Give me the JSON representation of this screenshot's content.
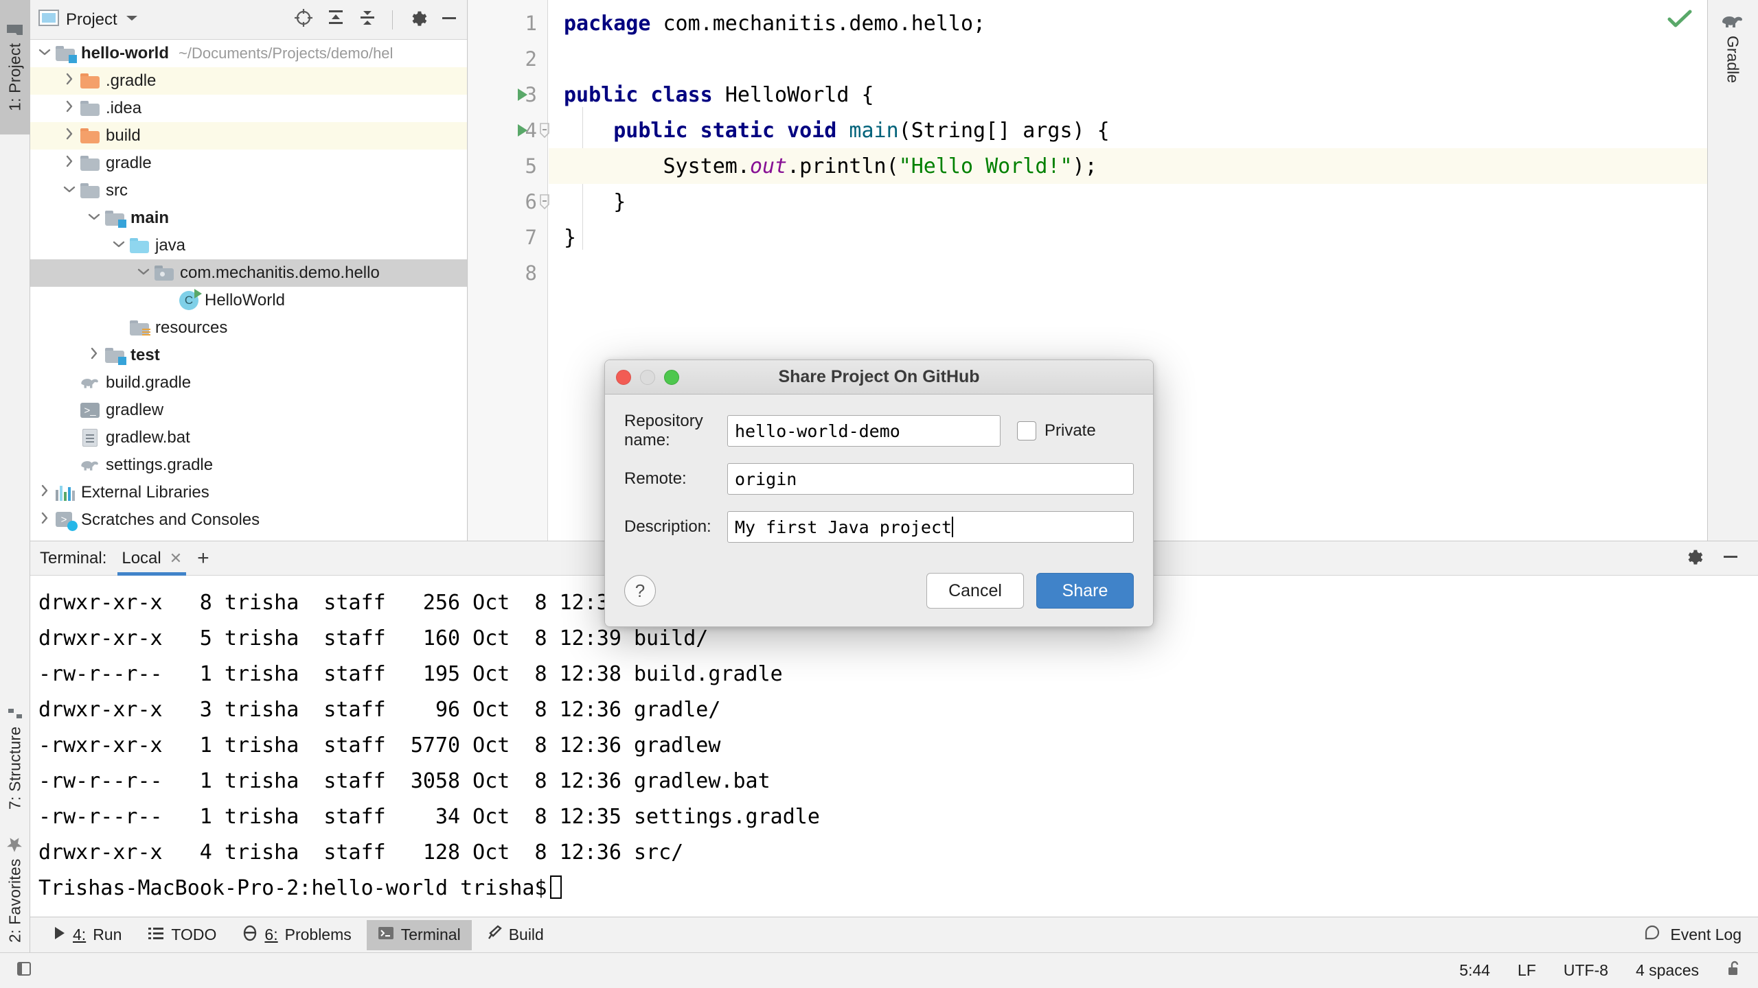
{
  "left_tabs": [
    {
      "label": "1: Project",
      "number": "1:",
      "name": "Project",
      "icon": "project-folder-icon",
      "active": true
    },
    {
      "label": "7: Structure",
      "number": "7:",
      "name": "Structure",
      "icon": "structure-icon",
      "active": false
    },
    {
      "label": "2: Favorites",
      "number": "2:",
      "name": "Favorites",
      "icon": "star-icon",
      "active": false
    }
  ],
  "right_tabs": [
    {
      "label": "Gradle",
      "icon": "gradle-elephant-icon"
    }
  ],
  "project_panel": {
    "title": "Project",
    "toolbar_icons": [
      "locate-icon",
      "expand-all-icon",
      "collapse-all-icon",
      "gear-icon",
      "hide-icon"
    ],
    "tree": [
      {
        "indent": 0,
        "twist": "v",
        "icon": "module-folder-icon",
        "label": "hello-world",
        "bold": true,
        "path": "~/Documents/Projects/demo/hel",
        "row": "plain"
      },
      {
        "indent": 1,
        "twist": ">",
        "icon": "folder-orange-icon",
        "label": ".gradle",
        "bold": false,
        "path": "",
        "row": "hl-yellow"
      },
      {
        "indent": 1,
        "twist": ">",
        "icon": "folder-grey-icon",
        "label": ".idea",
        "bold": false,
        "path": "",
        "row": "plain"
      },
      {
        "indent": 1,
        "twist": ">",
        "icon": "folder-orange-icon",
        "label": "build",
        "bold": false,
        "path": "",
        "row": "hl-yellow"
      },
      {
        "indent": 1,
        "twist": ">",
        "icon": "folder-grey-icon",
        "label": "gradle",
        "bold": false,
        "path": "",
        "row": "plain"
      },
      {
        "indent": 1,
        "twist": "v",
        "icon": "folder-grey-icon",
        "label": "src",
        "bold": false,
        "path": "",
        "row": "plain"
      },
      {
        "indent": 2,
        "twist": "v",
        "icon": "module-folder-icon",
        "label": "main",
        "bold": true,
        "path": "",
        "row": "plain"
      },
      {
        "indent": 3,
        "twist": "v",
        "icon": "folder-blue-icon",
        "label": "java",
        "bold": false,
        "path": "",
        "row": "plain"
      },
      {
        "indent": 4,
        "twist": "v",
        "icon": "package-icon",
        "label": "com.mechanitis.demo.hello",
        "bold": false,
        "path": "",
        "row": "selected"
      },
      {
        "indent": 5,
        "twist": "",
        "icon": "java-class-icon",
        "label": "HelloWorld",
        "bold": false,
        "path": "",
        "row": "plain"
      },
      {
        "indent": 3,
        "twist": "",
        "icon": "resources-folder-icon",
        "label": "resources",
        "bold": false,
        "path": "",
        "row": "plain"
      },
      {
        "indent": 2,
        "twist": ">",
        "icon": "module-folder-icon",
        "label": "test",
        "bold": true,
        "path": "",
        "row": "plain"
      },
      {
        "indent": 1,
        "twist": "",
        "icon": "gradle-elephant-icon",
        "label": "build.gradle",
        "bold": false,
        "path": "",
        "row": "plain"
      },
      {
        "indent": 1,
        "twist": "",
        "icon": "shell-script-icon",
        "label": "gradlew",
        "bold": false,
        "path": "",
        "row": "plain"
      },
      {
        "indent": 1,
        "twist": "",
        "icon": "text-file-icon",
        "label": "gradlew.bat",
        "bold": false,
        "path": "",
        "row": "plain"
      },
      {
        "indent": 1,
        "twist": "",
        "icon": "gradle-elephant-icon",
        "label": "settings.gradle",
        "bold": false,
        "path": "",
        "row": "plain"
      },
      {
        "indent": 0,
        "twist": ">",
        "icon": "external-libraries-icon",
        "label": "External Libraries",
        "bold": false,
        "path": "",
        "row": "plain"
      },
      {
        "indent": 0,
        "twist": ">",
        "icon": "scratches-icon",
        "label": "Scratches and Consoles",
        "bold": false,
        "path": "",
        "row": "plain"
      }
    ]
  },
  "editor": {
    "lines": [
      {
        "no": "1",
        "run": false,
        "fold": "",
        "current": false,
        "tokens": [
          {
            "t": "package ",
            "c": "kw"
          },
          {
            "t": "com.mechanitis.demo.hello;",
            "c": "pln"
          }
        ]
      },
      {
        "no": "2",
        "run": false,
        "fold": "",
        "current": false,
        "tokens": []
      },
      {
        "no": "3",
        "run": true,
        "fold": "",
        "current": false,
        "tokens": [
          {
            "t": "public class ",
            "c": "kw"
          },
          {
            "t": "HelloWorld {",
            "c": "pln"
          }
        ]
      },
      {
        "no": "4",
        "run": true,
        "fold": "-",
        "current": false,
        "tokens": [
          {
            "t": "    ",
            "c": "pln"
          },
          {
            "t": "public static void ",
            "c": "kw"
          },
          {
            "t": "main",
            "c": "mth"
          },
          {
            "t": "(String[] args) {",
            "c": "pln"
          }
        ]
      },
      {
        "no": "5",
        "run": false,
        "fold": "",
        "current": true,
        "tokens": [
          {
            "t": "        System.",
            "c": "pln"
          },
          {
            "t": "out",
            "c": "fld"
          },
          {
            "t": ".println(",
            "c": "pln"
          },
          {
            "t": "\"Hello World!\"",
            "c": "str"
          },
          {
            "t": ");",
            "c": "pln"
          }
        ]
      },
      {
        "no": "6",
        "run": false,
        "fold": "-",
        "current": false,
        "tokens": [
          {
            "t": "    }",
            "c": "pln"
          }
        ]
      },
      {
        "no": "7",
        "run": false,
        "fold": "",
        "current": false,
        "tokens": [
          {
            "t": "}",
            "c": "pln"
          }
        ]
      },
      {
        "no": "8",
        "run": false,
        "fold": "",
        "current": false,
        "tokens": []
      }
    ],
    "inspection_status": "ok-check"
  },
  "terminal": {
    "label": "Terminal:",
    "tab": "Local",
    "add_tab": "+",
    "lines": [
      "drwxr-xr-x   8 trisha  staff   256 Oct  8 12:39 .",
      "drwxr-xr-x   5 trisha  staff   160 Oct  8 12:39 build/",
      "-rw-r--r--   1 trisha  staff   195 Oct  8 12:38 build.gradle",
      "drwxr-xr-x   3 trisha  staff    96 Oct  8 12:36 gradle/",
      "-rwxr-xr-x   1 trisha  staff  5770 Oct  8 12:36 gradlew",
      "-rw-r--r--   1 trisha  staff  3058 Oct  8 12:36 gradlew.bat",
      "-rw-r--r--   1 trisha  staff    34 Oct  8 12:35 settings.gradle",
      "drwxr-xr-x   4 trisha  staff   128 Oct  8 12:36 src/"
    ],
    "prompt": "Trishas-MacBook-Pro-2:hello-world trisha$"
  },
  "bottom_bar": {
    "items": [
      {
        "label": "4: Run",
        "number": "4:",
        "text": "Run",
        "icon": "run-triangle-icon",
        "active": false
      },
      {
        "label": "TODO",
        "number": "",
        "text": "TODO",
        "icon": "todo-list-icon",
        "active": false
      },
      {
        "label": "6: Problems",
        "number": "6:",
        "text": "Problems",
        "icon": "problems-icon",
        "active": false
      },
      {
        "label": "Terminal",
        "number": "",
        "text": "Terminal",
        "icon": "terminal-icon",
        "active": true
      },
      {
        "label": "Build",
        "number": "",
        "text": "Build",
        "icon": "build-hammer-icon",
        "active": false
      }
    ],
    "event_log": "Event Log",
    "event_log_icon": "balloon-icon"
  },
  "status_bar": {
    "caret_position": "5:44",
    "line_separator": "LF",
    "encoding": "UTF-8",
    "indent": "4 spaces",
    "lock_icon": "unlocked-padlock-icon",
    "left_icon": "toggle-sidebar-icon"
  },
  "dialog": {
    "title": "Share Project On GitHub",
    "fields": [
      {
        "label": "Repository name:",
        "value": "hello-world-demo",
        "short": true,
        "caret": false
      },
      {
        "label": "Remote:",
        "value": "origin",
        "short": false,
        "caret": false
      },
      {
        "label": "Description:",
        "value": "My first Java project",
        "short": false,
        "caret": true
      }
    ],
    "checkbox": {
      "label": "Private",
      "checked": false
    },
    "help_label": "?",
    "cancel_label": "Cancel",
    "share_label": "Share",
    "accent_color": "#4083c9"
  }
}
